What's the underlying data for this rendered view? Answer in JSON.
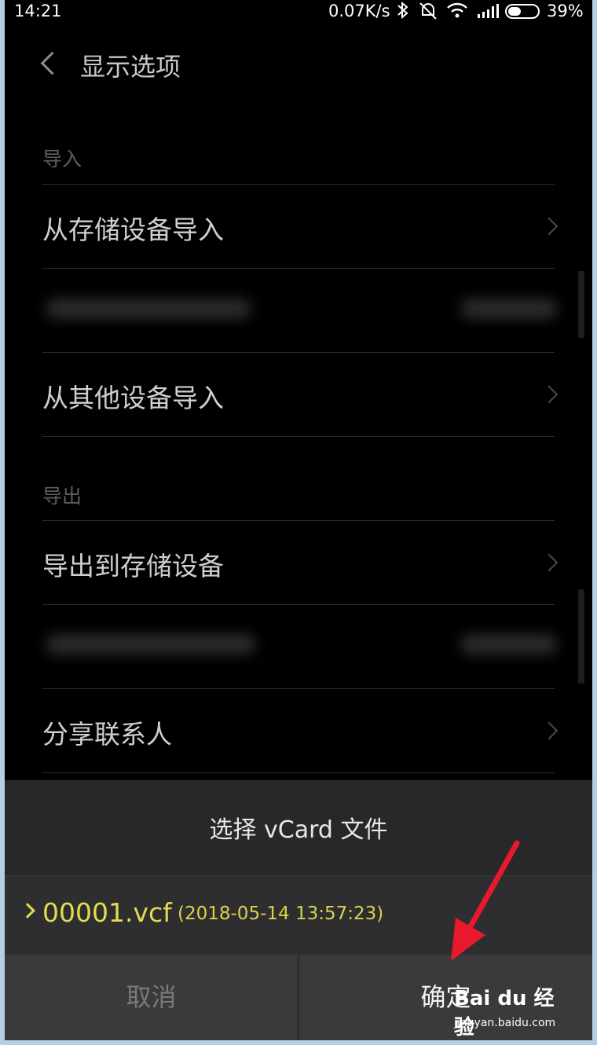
{
  "status_bar": {
    "time": "14:21",
    "net_speed": "0.07K/s",
    "battery_pct": "39%"
  },
  "header": {
    "title": "显示选项"
  },
  "sections": {
    "import_label": "导入",
    "export_label": "导出"
  },
  "rows": {
    "import_storage": "从存储设备导入",
    "import_other": "从其他设备导入",
    "export_storage": "导出到存储设备",
    "share_contacts": "分享联系人"
  },
  "dialog": {
    "title": "选择 vCard 文件",
    "file_name": "00001.vcf",
    "file_date": "(2018-05-14 13:57:23)",
    "cancel_label": "取消",
    "ok_label": "确定"
  },
  "watermark": {
    "brand": "Bai du 经验",
    "url": "jingyan.baidu.com"
  },
  "colors": {
    "accent_yellow": "#e4dc4e",
    "annotation_red": "#e8192c"
  }
}
